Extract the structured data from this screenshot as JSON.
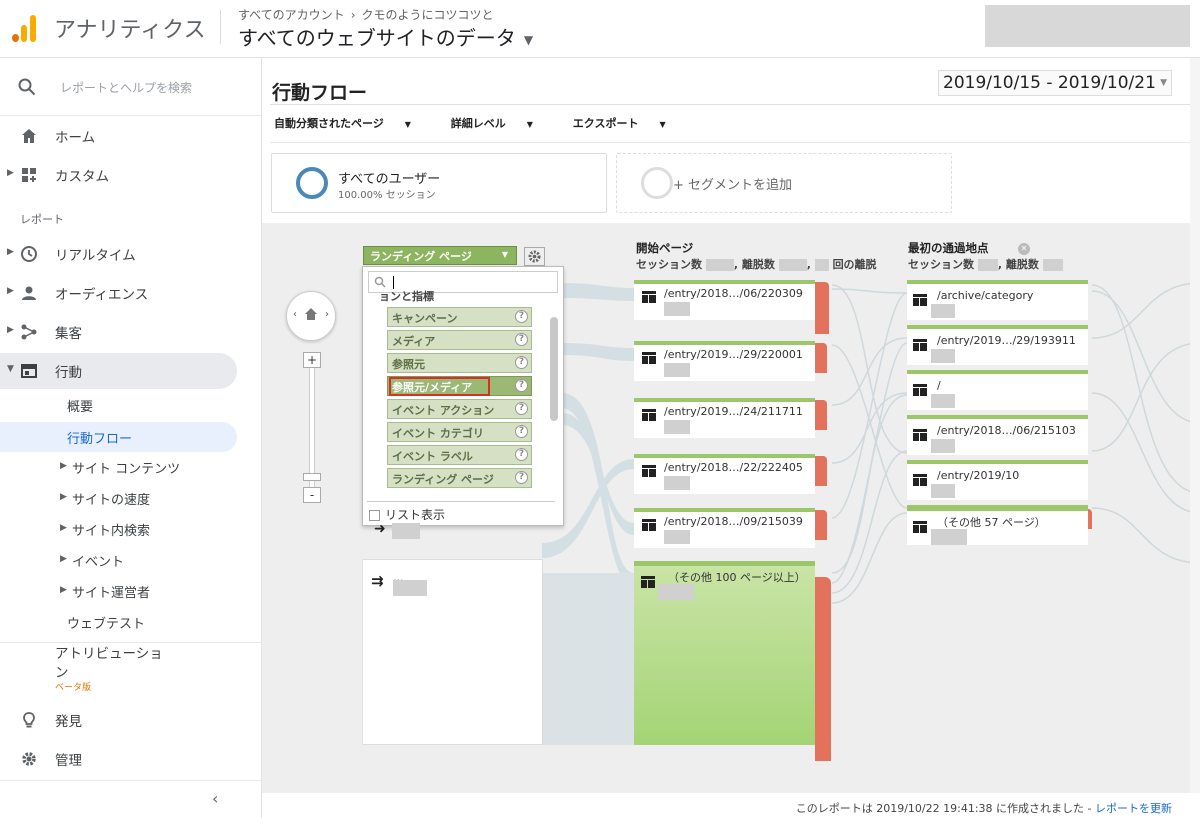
{
  "header": {
    "app_title": "アナリティクス",
    "breadcrumb_accounts": "すべてのアカウント",
    "breadcrumb_property": "クモのようにコツコツと",
    "site_title": "すべてのウェブサイトのデータ"
  },
  "sidebar": {
    "search_placeholder": "レポートとヘルプを検索",
    "home": "ホーム",
    "custom": "カスタム",
    "reports_label": "レポート",
    "realtime": "リアルタイム",
    "audience": "オーディエンス",
    "acquisition": "集客",
    "behavior": "行動",
    "sub": {
      "overview": "概要",
      "flow": "行動フロー",
      "site_content": "サイト コンテンツ",
      "site_speed": "サイトの速度",
      "site_search": "サイト内検索",
      "events": "イベント",
      "publisher": "サイト運営者",
      "experiments": "ウェブテスト"
    },
    "attribution_line1": "アトリビューショ",
    "attribution_line2": "ン",
    "beta": "ベータ版",
    "discover": "発見",
    "admin": "管理",
    "collapse_glyph": "‹"
  },
  "main": {
    "page_title": "行動フロー",
    "date_range": "2019/10/15 - 2019/10/21",
    "toolbar": {
      "auto_pages": "自動分類されたページ",
      "detail_level": "詳細レベル",
      "export": "エクスポート"
    },
    "segment_all": "すべてのユーザー",
    "segment_all_sub": "100.00% セッション",
    "segment_add": "+ セグメントを追加",
    "landing_button": "ランディング ページ",
    "dropdown": {
      "group_label": "ョンと指標",
      "items": [
        "キャンペーン",
        "メディア",
        "参照元",
        "参照元/メディア",
        "イベント アクション",
        "イベント カテゴリ",
        "イベント ラベル",
        "ランディング ページ"
      ],
      "selected_index": 3,
      "list_view": "リスト表示"
    },
    "left_more": "...",
    "col_start": {
      "title": "開始ページ",
      "sessions": "セッション数",
      "dropoffs": "離脱数",
      "times": "回の離脱"
    },
    "col_first": {
      "title": "最初の通過地点",
      "sessions": "セッション数",
      "dropoffs": "離脱数"
    },
    "start_nodes": [
      "/entry/2018…/06/220309",
      "/entry/2019…/29/220001",
      "/entry/2019…/24/211711",
      "/entry/2018…/22/222405",
      "/entry/2018…/09/215039"
    ],
    "start_other": "（その他 100 ページ以上）",
    "first_nodes": [
      "/archive/category",
      "/entry/2019…/29/193911",
      "/",
      "/entry/2018…/06/215103",
      "/entry/2019/10",
      "（その他 57 ページ）"
    ],
    "footer_text": "このレポートは 2019/10/22 19:41:38 に作成されました - ",
    "footer_link": "レポートを更新"
  },
  "colors": {
    "accent_green": "#9bc66a",
    "dropoff_red": "#e2725b",
    "segment_blue": "#4a88b8"
  }
}
